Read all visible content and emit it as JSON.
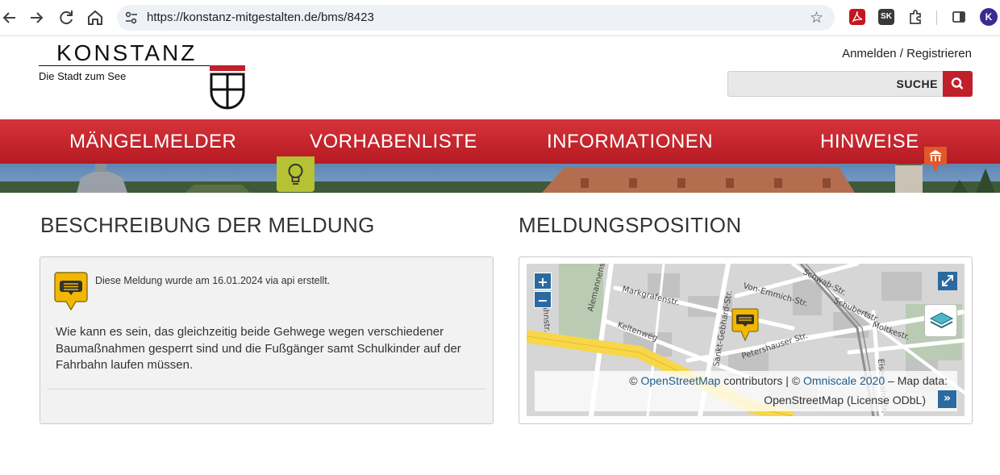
{
  "browser": {
    "url": "https://konstanz-mitgestalten.de/bms/8423",
    "profile_initial": "K",
    "ext_sk_label": "SK",
    "icons": [
      "back-icon",
      "forward-icon",
      "reload-icon",
      "home-icon",
      "site-info-icon",
      "bookmark-star-icon",
      "pdf-extension-icon",
      "sk-extension-icon",
      "extensions-puzzle-icon",
      "side-panel-icon",
      "profile-avatar"
    ]
  },
  "header": {
    "logo_word": "KONSTANZ",
    "logo_subtitle": "Die Stadt zum See",
    "login_label": "Anmelden / Registrieren",
    "search_label": "SUCHE"
  },
  "nav": {
    "items": [
      "MÄNGELMELDER",
      "VORHABENLISTE",
      "INFORMATIONEN",
      "HINWEISE"
    ]
  },
  "description": {
    "title": "BESCHREIBUNG DER MELDUNG",
    "meta": "Diese Meldung wurde am 16.01.2024 via api erstellt.",
    "text": "Wie kann es sein, das gleichzeitig beide Gehwege wegen verschiedener Baumaßnahmen gesperrt sind und die Fußgänger samt Schulkinder auf der Fahrbahn laufen müssen."
  },
  "position": {
    "title": "MELDUNGSPOSITION",
    "zoom_in": "+",
    "zoom_out": "−",
    "attrib_prefix": "© ",
    "attrib_osm": "OpenStreetMap",
    "attrib_mid": " contributors | © ",
    "attrib_omniscale": "Omniscale 2020",
    "attrib_suffix": " – Map data:",
    "attrib_line2": "OpenStreetMap (License ODbL)",
    "attrib_toggle": "»",
    "street_labels": [
      "Alemannenstr.",
      "Markgrafenstr.",
      "Keltenweg",
      "Sankt-Gebhard-Str.",
      "Von-Emmich-Str.",
      "Moltkestr.",
      "Schwab-Str.",
      "Petershauser Str.",
      "Eisenbahnstr.",
      "Jahnstr.",
      "Schubertstr."
    ]
  },
  "colors": {
    "brand_red": "#c0202a",
    "marker_yellow": "#f2b700",
    "map_button_blue": "#2a6aa0",
    "bulb_tab_green": "#b5c234"
  }
}
